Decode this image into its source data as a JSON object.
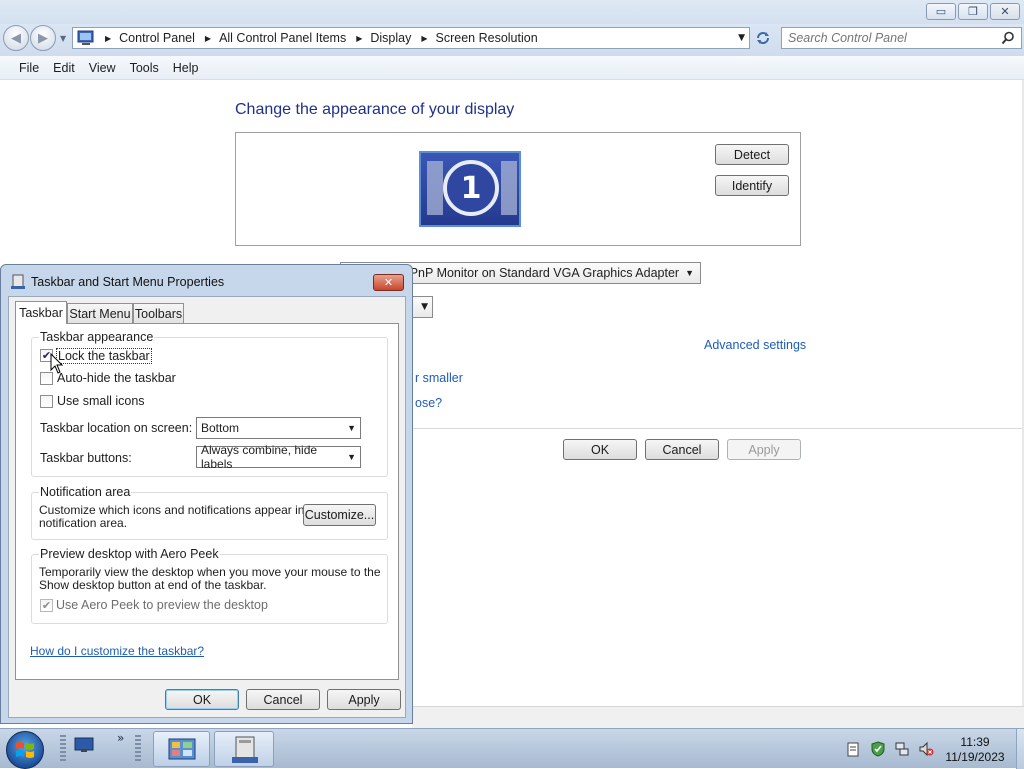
{
  "window": {
    "controls": {
      "minimize": "▭",
      "restore": "❐",
      "close": "✕"
    }
  },
  "address": {
    "crumbs": [
      "Control Panel",
      "All Control Panel Items",
      "Display",
      "Screen Resolution"
    ]
  },
  "search": {
    "placeholder": "Search Control Panel"
  },
  "menu": {
    "items": [
      "File",
      "Edit",
      "View",
      "Tools",
      "Help"
    ]
  },
  "main": {
    "heading": "Change the appearance of your display",
    "monitor_number": "1",
    "detect_label": "Detect",
    "identify_label": "Identify",
    "display_value": "n-PnP Monitor on Standard VGA Graphics Adapter",
    "advanced_link": "Advanced settings",
    "smaller_link": "r smaller",
    "choose_link": "ose?",
    "ok_label": "OK",
    "cancel_label": "Cancel",
    "apply_label": "Apply"
  },
  "dialog": {
    "title": "Taskbar and Start Menu Properties",
    "tabs": [
      "Taskbar",
      "Start Menu",
      "Toolbars"
    ],
    "appearance": {
      "title": "Taskbar appearance",
      "lock": {
        "label": "Lock the taskbar",
        "checked": true
      },
      "autohide": {
        "label": "Auto-hide the taskbar",
        "checked": false
      },
      "small_icons": {
        "label": "Use small icons",
        "checked": false
      },
      "location_label": "Taskbar location on screen:",
      "location_value": "Bottom",
      "buttons_label": "Taskbar buttons:",
      "buttons_value": "Always combine, hide labels"
    },
    "notification": {
      "title": "Notification area",
      "text_line1": "Customize which icons and notifications appear in the",
      "text_line2": "notification area.",
      "customize_label": "Customize..."
    },
    "aero": {
      "title": "Preview desktop with Aero Peek",
      "text_line1": "Temporarily view the desktop when you move your mouse to the",
      "text_line2": "Show desktop button at end of the taskbar.",
      "checkbox_label": "Use Aero Peek to preview the desktop",
      "checked": true
    },
    "help_link": "How do I customize the taskbar?",
    "ok_label": "OK",
    "cancel_label": "Cancel",
    "apply_label": "Apply"
  },
  "taskbar": {
    "time": "11:39",
    "date": "11/19/2023",
    "overflow": "»"
  }
}
